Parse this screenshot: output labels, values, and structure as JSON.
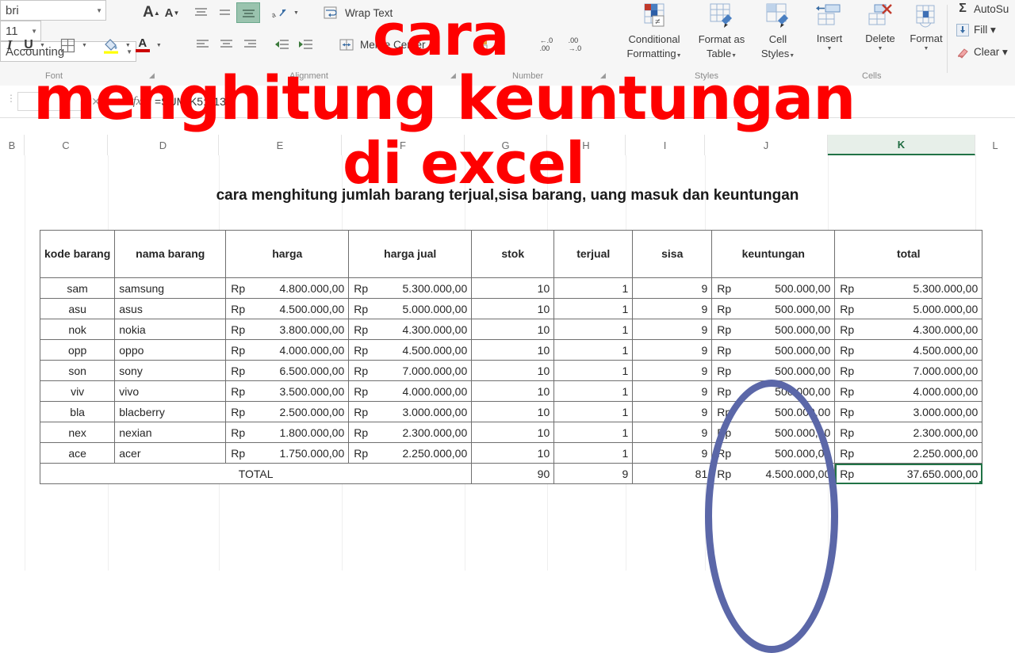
{
  "ribbon": {
    "font_name": "bri",
    "font_size": "11",
    "grow_font_icon": "A",
    "shrink_font_icon": "A",
    "italic_label": "I",
    "underline_label": "U",
    "borders_icon": "borders-icon",
    "fill_color_icon": "fill-color-icon",
    "font_color_label": "A",
    "wrap_text_label": "Wrap Text",
    "merge_center_label": "Merge  Center",
    "number_format": "Accounting",
    "increase_decimal_label": ".00",
    "decrease_decimal_label": ".00",
    "groups": {
      "font": "Font",
      "alignment": "Alignment",
      "number": "Number",
      "styles": "Styles",
      "cells": "Cells"
    },
    "buttons": [
      {
        "name": "conditional-formatting",
        "line1": "Conditional",
        "line2": "Formatting",
        "arrow": "▾"
      },
      {
        "name": "format-as-table",
        "line1": "Format as",
        "line2": "Table",
        "arrow": "▾"
      },
      {
        "name": "cell-styles",
        "line1": "Cell",
        "line2": "Styles",
        "arrow": "▾"
      },
      {
        "name": "insert",
        "line1": "Insert",
        "line2": "",
        "arrow": "▾"
      },
      {
        "name": "delete",
        "line1": "Delete",
        "line2": "",
        "arrow": "▾"
      },
      {
        "name": "format",
        "line1": "Format",
        "line2": "",
        "arrow": "▾"
      }
    ],
    "editing": [
      {
        "name": "autosum",
        "label": "AutoSu",
        "icon": "sigma-icon"
      },
      {
        "name": "fill",
        "label": "Fill ▾",
        "icon": "fill-down-icon"
      },
      {
        "name": "clear",
        "label": "Clear ▾",
        "icon": "eraser-icon"
      }
    ]
  },
  "formula_bar": {
    "name_box": "",
    "cancel_icon": "cancel-icon",
    "enter_icon": "check-icon",
    "fx_icon": "fx",
    "formula": "=SUM(K5:K13"
  },
  "columns": [
    "B",
    "C",
    "D",
    "E",
    "F",
    "G",
    "H",
    "I",
    "J",
    "K",
    "L"
  ],
  "selected_column": "K",
  "sheet": {
    "title": "cara menghitung jumlah barang terjual,sisa barang,  uang masuk dan keuntungan"
  },
  "table": {
    "headers": [
      "kode barang",
      "nama barang",
      "harga",
      "harga jual",
      "stok",
      "terjual",
      "sisa",
      "keuntungan",
      "total"
    ],
    "currency_symbol": "Rp",
    "rows": [
      {
        "kode": "sam",
        "nama": "samsung",
        "harga": "4.800.000,00",
        "harga_jual": "5.300.000,00",
        "stok": "10",
        "terjual": "1",
        "sisa": "9",
        "keuntungan": "500.000,00",
        "total": "5.300.000,00"
      },
      {
        "kode": "asu",
        "nama": "asus",
        "harga": "4.500.000,00",
        "harga_jual": "5.000.000,00",
        "stok": "10",
        "terjual": "1",
        "sisa": "9",
        "keuntungan": "500.000,00",
        "total": "5.000.000,00"
      },
      {
        "kode": "nok",
        "nama": "nokia",
        "harga": "3.800.000,00",
        "harga_jual": "4.300.000,00",
        "stok": "10",
        "terjual": "1",
        "sisa": "9",
        "keuntungan": "500.000,00",
        "total": "4.300.000,00"
      },
      {
        "kode": "opp",
        "nama": "oppo",
        "harga": "4.000.000,00",
        "harga_jual": "4.500.000,00",
        "stok": "10",
        "terjual": "1",
        "sisa": "9",
        "keuntungan": "500.000,00",
        "total": "4.500.000,00"
      },
      {
        "kode": "son",
        "nama": "sony",
        "harga": "6.500.000,00",
        "harga_jual": "7.000.000,00",
        "stok": "10",
        "terjual": "1",
        "sisa": "9",
        "keuntungan": "500.000,00",
        "total": "7.000.000,00"
      },
      {
        "kode": "viv",
        "nama": "vivo",
        "harga": "3.500.000,00",
        "harga_jual": "4.000.000,00",
        "stok": "10",
        "terjual": "1",
        "sisa": "9",
        "keuntungan": "500.000,00",
        "total": "4.000.000,00"
      },
      {
        "kode": "bla",
        "nama": "blacberry",
        "harga": "2.500.000,00",
        "harga_jual": "3.000.000,00",
        "stok": "10",
        "terjual": "1",
        "sisa": "9",
        "keuntungan": "500.000,00",
        "total": "3.000.000,00"
      },
      {
        "kode": "nex",
        "nama": "nexian",
        "harga": "1.800.000,00",
        "harga_jual": "2.300.000,00",
        "stok": "10",
        "terjual": "1",
        "sisa": "9",
        "keuntungan": "500.000,00",
        "total": "2.300.000,00"
      },
      {
        "kode": "ace",
        "nama": "acer",
        "harga": "1.750.000,00",
        "harga_jual": "2.250.000,00",
        "stok": "10",
        "terjual": "1",
        "sisa": "9",
        "keuntungan": "500.000,00",
        "total": "2.250.000,00"
      }
    ],
    "total_row": {
      "label": "TOTAL",
      "stok": "90",
      "terjual": "9",
      "sisa": "81",
      "keuntungan": "4.500.000,00",
      "total": "37.650.000,00"
    }
  },
  "annotations": {
    "ellipse_color": "#5b67a8",
    "ellipse_name": "keuntungan-column-highlight",
    "overlay_color": "#fe0000",
    "overlay_line1": "cara",
    "overlay_line2": "menghitung keuntungan",
    "overlay_line3": "di excel"
  }
}
